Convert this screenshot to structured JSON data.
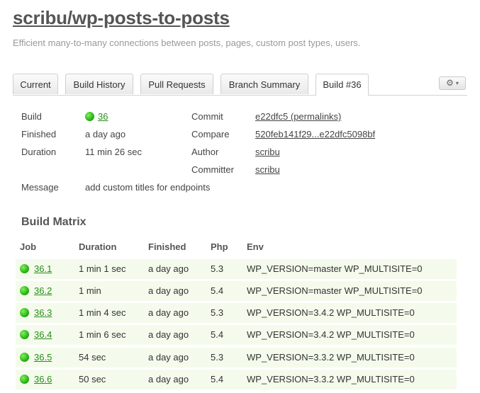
{
  "repo": {
    "title": "scribu/wp-posts-to-posts",
    "description": "Efficient many-to-many connections between posts, pages, custom post types, users."
  },
  "tabs": [
    {
      "label": "Current"
    },
    {
      "label": "Build History"
    },
    {
      "label": "Pull Requests"
    },
    {
      "label": "Branch Summary"
    },
    {
      "label": "Build #36",
      "active": true
    }
  ],
  "tools": {
    "icon": "gear-icon",
    "caret": "▾"
  },
  "summary": {
    "build_label": "Build",
    "build_value": "36",
    "build_status": "passed",
    "finished_label": "Finished",
    "finished_value": "a day ago",
    "duration_label": "Duration",
    "duration_value": "11 min 26 sec",
    "message_label": "Message",
    "message_value": "add custom titles for endpoints",
    "commit_label": "Commit",
    "commit_value": "e22dfc5 (permalinks)",
    "compare_label": "Compare",
    "compare_value": "520feb141f29...e22dfc5098bf",
    "author_label": "Author",
    "author_value": "scribu",
    "committer_label": "Committer",
    "committer_value": "scribu"
  },
  "matrix": {
    "title": "Build Matrix",
    "headers": {
      "job": "Job",
      "duration": "Duration",
      "finished": "Finished",
      "php": "Php",
      "env": "Env"
    },
    "rows": [
      {
        "job": "36.1",
        "duration": "1 min 1 sec",
        "finished": "a day ago",
        "php": "5.3",
        "env": "WP_VERSION=master WP_MULTISITE=0"
      },
      {
        "job": "36.2",
        "duration": "1 min",
        "finished": "a day ago",
        "php": "5.4",
        "env": "WP_VERSION=master WP_MULTISITE=0"
      },
      {
        "job": "36.3",
        "duration": "1 min 4 sec",
        "finished": "a day ago",
        "php": "5.3",
        "env": "WP_VERSION=3.4.2 WP_MULTISITE=0"
      },
      {
        "job": "36.4",
        "duration": "1 min 6 sec",
        "finished": "a day ago",
        "php": "5.4",
        "env": "WP_VERSION=3.4.2 WP_MULTISITE=0"
      },
      {
        "job": "36.5",
        "duration": "54 sec",
        "finished": "a day ago",
        "php": "5.3",
        "env": "WP_VERSION=3.3.2 WP_MULTISITE=0"
      },
      {
        "job": "36.6",
        "duration": "50 sec",
        "finished": "a day ago",
        "php": "5.4",
        "env": "WP_VERSION=3.3.2 WP_MULTISITE=0"
      }
    ]
  },
  "colors": {
    "success": "#2a8c1a",
    "row_bg": "#f4fbec"
  }
}
